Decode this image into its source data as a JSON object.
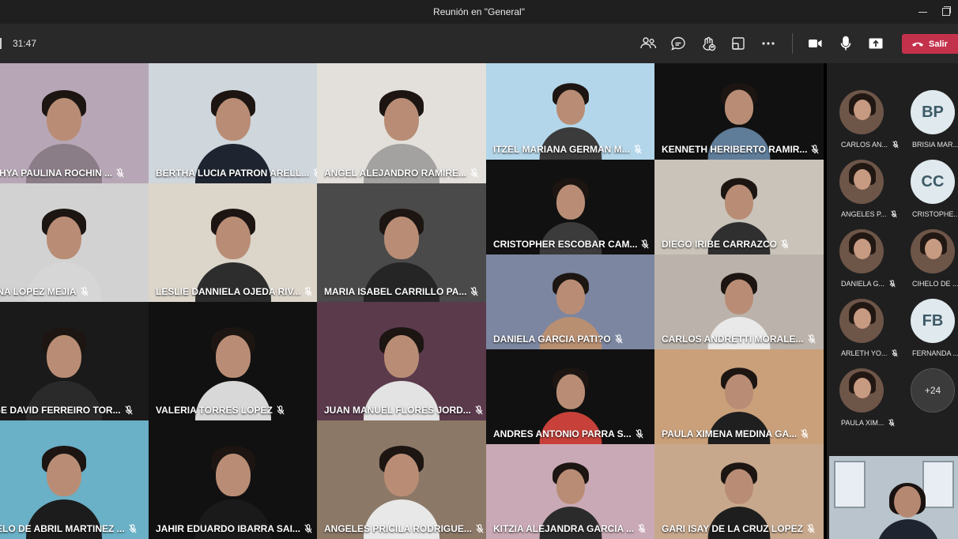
{
  "window": {
    "title": "Reunión en \"General\""
  },
  "toolbar": {
    "timer": "31:47",
    "leave_label": "Salir"
  },
  "colors": {
    "accent_leave": "#c4314b",
    "toolbar_bg": "#292929",
    "titlebar_bg": "#1f1f1f",
    "sidebar_bg": "#1f1f1f"
  },
  "tiles": [
    {
      "name": "NTHYA PAULINA ROCHIN ...",
      "bg": "#b7a7b6",
      "body": "#8b7d88"
    },
    {
      "name": "BERTHA LUCIA PATRON ARELL...",
      "bg": "#cfd6dc",
      "body": "#1e2530"
    },
    {
      "name": "ANGEL ALEJANDRO RAMIRE...",
      "bg": "#e3e0dc",
      "body": "#a3a2a0"
    },
    {
      "name": "ITZEL MARIANA GERMAN M...",
      "bg": "#b3d6ea",
      "body": "#3b3b3b"
    },
    {
      "name": "KENNETH HERIBERTO RAMIR...",
      "bg": "#111111",
      "body": "#5f7c99"
    },
    {
      "name": "MINA LOPEZ MEJIA",
      "bg": "#d2d2d2",
      "body": "#d6d6d6"
    },
    {
      "name": "LESLIE DANNIELA OJEDA RIV...",
      "bg": "#dcd5ca",
      "body": "#2d2d2d"
    },
    {
      "name": "MARIA ISABEL CARRILLO PA...",
      "bg": "#4a4a4a",
      "body": "#252525"
    },
    {
      "name": "CRISTOPHER ESCOBAR CAM...",
      "bg": "#111111",
      "body": "#3b3b3b"
    },
    {
      "name": "DIEGO IRIBE CARRAZCO",
      "bg": "#c9c3ba",
      "body": "#2f2f2f"
    },
    {
      "name": "DANIELA GARCIA PATI?O",
      "bg": "#7c86a0",
      "body": "#b98f72"
    },
    {
      "name": "CARLOS ANDRETTI MORALE...",
      "bg": "#bbb3ab",
      "body": "#e9e9e9"
    },
    {
      "name": "RGE DAVID FERREIRO TOR...",
      "bg": "#1a1a1a",
      "body": "#2a2a2a"
    },
    {
      "name": "VALERIA TORRES LOPEZ",
      "bg": "#111111",
      "body": "#d8d8d8"
    },
    {
      "name": "JUAN MANUEL FLORES JORD...",
      "bg": "#5b3a4c",
      "body": "#e3e3e3"
    },
    {
      "name": "ANDRES ANTONIO PARRA S...",
      "bg": "#111111",
      "body": "#c7413a"
    },
    {
      "name": "PAULA XIMENA MEDINA GA...",
      "bg": "#caa07a",
      "body": "#1f1f1f"
    },
    {
      "name": "CIELO DE ABRIL MARTINEZ ...",
      "bg": "#6ab0c6",
      "body": "#1c1c1c"
    },
    {
      "name": "JAHIR EDUARDO IBARRA SAI...",
      "bg": "#111111",
      "body": "#1a1a1a"
    },
    {
      "name": "ANGELES PRICILA RODRIGUE...",
      "bg": "#8c7867",
      "body": "#e8e8e8"
    },
    {
      "name": "KITZIA ALEJANDRA GARCIA ...",
      "bg": "#c9a9b5",
      "body": "#2b2b2b"
    },
    {
      "name": "GARI ISAY DE LA CRUZ LOPEZ",
      "bg": "#c7a88c",
      "body": "#1e1e1e"
    }
  ],
  "participants": [
    {
      "name": "CARLOS AN...",
      "type": "photo"
    },
    {
      "name": "BRISIA MAR...",
      "type": "initials",
      "initials": "BP"
    },
    {
      "name": "ANGELES P...",
      "type": "photo"
    },
    {
      "name": "CRISTOPHE...",
      "type": "initials",
      "initials": "CC"
    },
    {
      "name": "DANIELA G...",
      "type": "photo"
    },
    {
      "name": "CIHELO DE ...",
      "type": "photo"
    },
    {
      "name": "ARLETH YO...",
      "type": "photo"
    },
    {
      "name": "FERNANDA ...",
      "type": "initials",
      "initials": "FB"
    },
    {
      "name": "PAULA XIM...",
      "type": "photo"
    },
    {
      "name": "",
      "type": "more",
      "initials": "+24"
    }
  ]
}
